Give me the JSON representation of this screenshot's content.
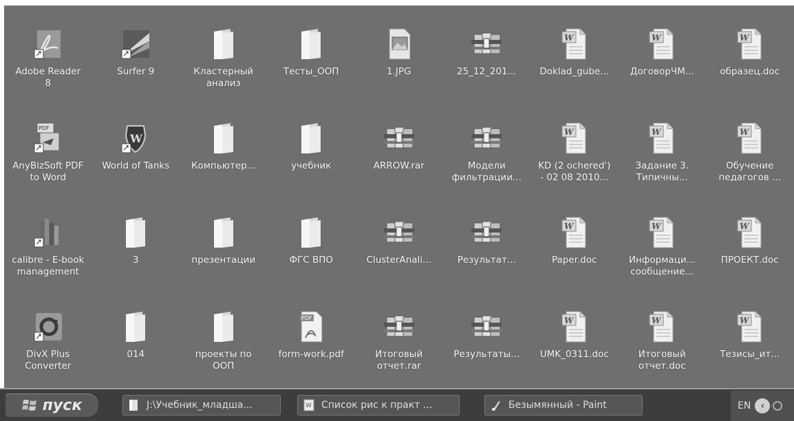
{
  "desktop": {
    "icons": [
      {
        "label": "Adobe Reader\n8",
        "icon": "adobe-reader-icon",
        "type": "adobe"
      },
      {
        "label": "Surfer 9",
        "icon": "surfer-icon",
        "type": "surfer"
      },
      {
        "label": "Кластерный\nанализ",
        "icon": "folder-icon",
        "type": "folder"
      },
      {
        "label": "Тесты_ООП",
        "icon": "folder-icon",
        "type": "folder"
      },
      {
        "label": "1.JPG",
        "icon": "image-file-icon",
        "type": "jpg"
      },
      {
        "label": "25_12_201...",
        "icon": "archive-icon",
        "type": "rar"
      },
      {
        "label": "Doklad_gube...",
        "icon": "word-document-icon",
        "type": "doc"
      },
      {
        "label": "ДоговорЧМ...",
        "icon": "word-document-icon",
        "type": "doc"
      },
      {
        "label": "образец.doc",
        "icon": "word-document-icon",
        "type": "doc"
      },
      {
        "label": "AnyBizSoft PDF\nto Word",
        "icon": "pdf-to-word-icon",
        "type": "anybiz"
      },
      {
        "label": "World of Tanks",
        "icon": "world-of-tanks-icon",
        "type": "wot"
      },
      {
        "label": "Компьютер...",
        "icon": "folder-icon",
        "type": "folder"
      },
      {
        "label": "учебник",
        "icon": "folder-icon",
        "type": "folder"
      },
      {
        "label": "ARROW.rar",
        "icon": "archive-icon",
        "type": "rar"
      },
      {
        "label": "Модели\nфильтрации...",
        "icon": "archive-icon",
        "type": "rar"
      },
      {
        "label": "KD (2 ochered')\n- 02 08 2010...",
        "icon": "word-document-icon",
        "type": "doc"
      },
      {
        "label": "Задание 3.\nТипичны...",
        "icon": "word-document-icon",
        "type": "doc"
      },
      {
        "label": "Обучение\nпедагогов ...",
        "icon": "word-document-icon",
        "type": "doc"
      },
      {
        "label": "calibre - E-book\nmanagement",
        "icon": "calibre-icon",
        "type": "calibre"
      },
      {
        "label": "3",
        "icon": "folder-icon",
        "type": "folder"
      },
      {
        "label": "презентации",
        "icon": "folder-icon",
        "type": "folder"
      },
      {
        "label": "ФГС ВПО",
        "icon": "folder-icon",
        "type": "folder"
      },
      {
        "label": "ClusterAnali...",
        "icon": "archive-icon",
        "type": "rar"
      },
      {
        "label": "Результат...",
        "icon": "archive-icon",
        "type": "rar"
      },
      {
        "label": "Paper.doc",
        "icon": "word-document-icon",
        "type": "doc"
      },
      {
        "label": "Информаци...\nсообщение...",
        "icon": "word-document-icon",
        "type": "doc"
      },
      {
        "label": "ПРОЕКТ.doc",
        "icon": "word-document-icon",
        "type": "doc"
      },
      {
        "label": "DivX Plus\nConverter",
        "icon": "divx-converter-icon",
        "type": "divx"
      },
      {
        "label": "014",
        "icon": "folder-icon",
        "type": "folder"
      },
      {
        "label": "проекты по\nООП",
        "icon": "folder-icon",
        "type": "folder"
      },
      {
        "label": "form-work.pdf",
        "icon": "pdf-file-icon",
        "type": "pdf"
      },
      {
        "label": "Итоговый\nотчет.rar",
        "icon": "archive-icon",
        "type": "rar"
      },
      {
        "label": "Результаты...",
        "icon": "archive-icon",
        "type": "rar"
      },
      {
        "label": "UMK_0311.doc",
        "icon": "word-document-icon",
        "type": "doc"
      },
      {
        "label": "Итоговый\nотчет.doc",
        "icon": "word-document-icon",
        "type": "doc"
      },
      {
        "label": "Тезисы_ит...",
        "icon": "word-document-icon",
        "type": "doc"
      }
    ]
  },
  "taskbar": {
    "start_label": "пуск",
    "tasks": [
      {
        "label": "J:\\Учебник_младша...",
        "icon": "folder-icon"
      },
      {
        "label": "Список рис к практ ...",
        "icon": "word-document-icon"
      },
      {
        "label": "Безымянный - Paint",
        "icon": "paint-icon"
      }
    ],
    "tray": {
      "language": "EN"
    }
  },
  "colors": {
    "desktop_bg": "#6f6f6f",
    "taskbar_bg": "#3d3d3d"
  }
}
